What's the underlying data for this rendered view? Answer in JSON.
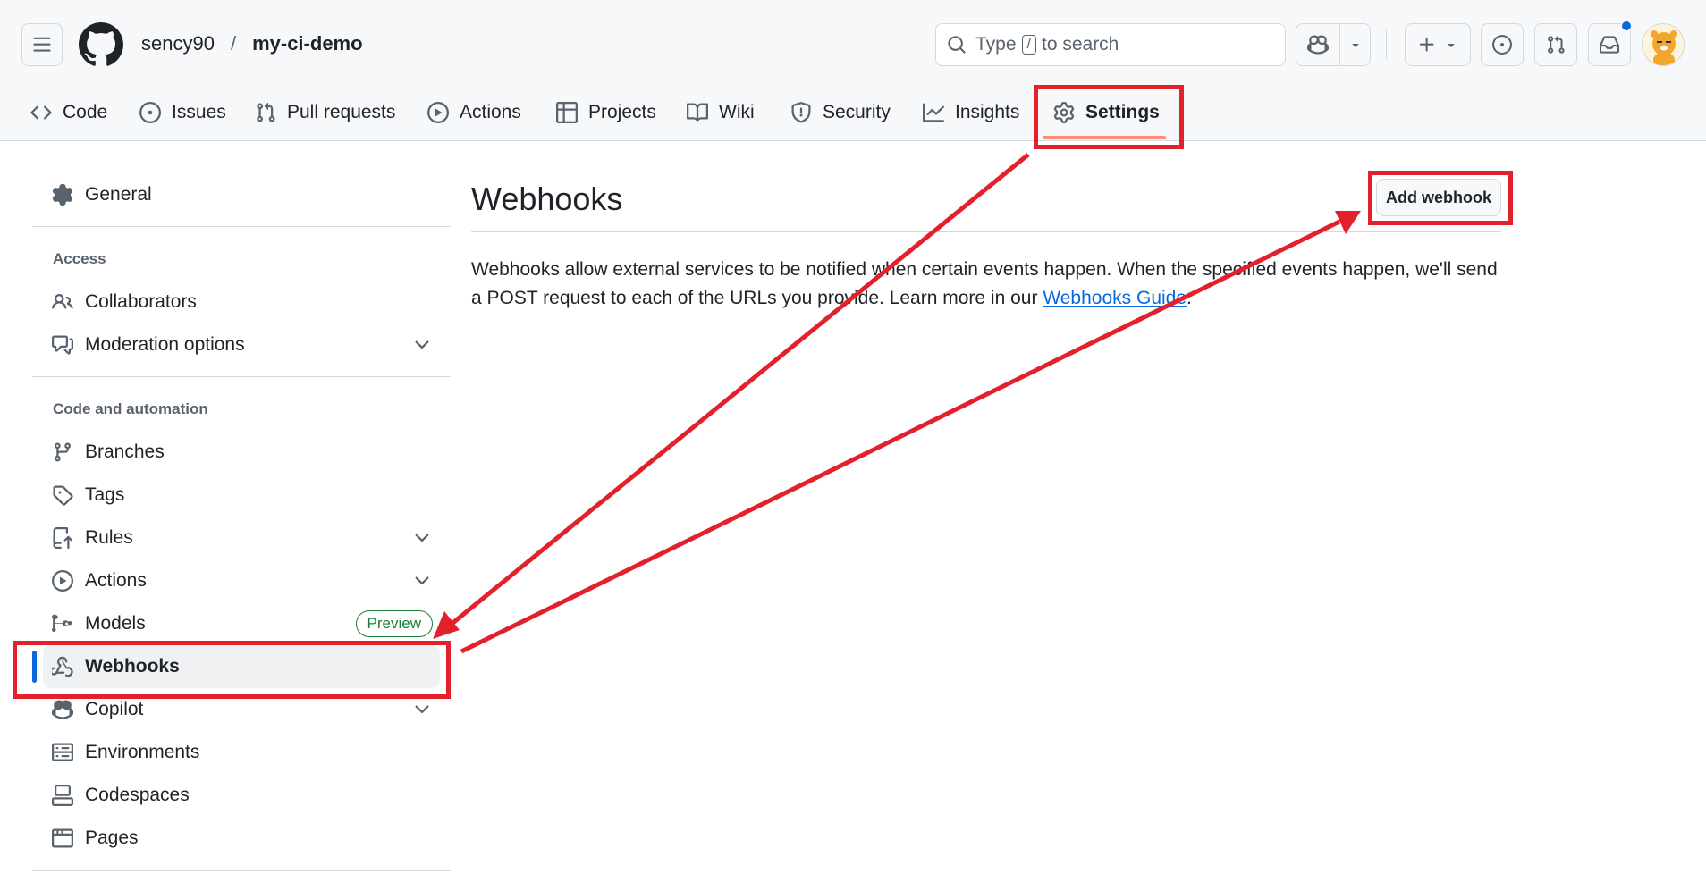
{
  "topbar": {
    "owner": "sency90",
    "separator": "/",
    "repo": "my-ci-demo",
    "search_prefix": "Type",
    "search_key": "/",
    "search_suffix": "to search"
  },
  "tabs": [
    {
      "label": "Code",
      "icon": "code-icon"
    },
    {
      "label": "Issues",
      "icon": "issue-icon"
    },
    {
      "label": "Pull requests",
      "icon": "pull-request-icon"
    },
    {
      "label": "Actions",
      "icon": "play-icon"
    },
    {
      "label": "Projects",
      "icon": "table-icon"
    },
    {
      "label": "Wiki",
      "icon": "book-icon"
    },
    {
      "label": "Security",
      "icon": "shield-icon"
    },
    {
      "label": "Insights",
      "icon": "graph-icon"
    },
    {
      "label": "Settings",
      "icon": "gear-icon",
      "active": true
    }
  ],
  "sidebar": {
    "general": "General",
    "access_heading": "Access",
    "collaborators": "Collaborators",
    "moderation": "Moderation options",
    "code_heading": "Code and automation",
    "branches": "Branches",
    "tags": "Tags",
    "rules": "Rules",
    "actions": "Actions",
    "models": "Models",
    "models_badge": "Preview",
    "webhooks": "Webhooks",
    "copilot": "Copilot",
    "environments": "Environments",
    "codespaces": "Codespaces",
    "pages": "Pages"
  },
  "main": {
    "title": "Webhooks",
    "add_button": "Add webhook",
    "description_line1": "Webhooks allow external services to be notified when certain events happen. When the specified events happen, we'll send",
    "description_line2": "a POST request to each of the URLs you provide. Learn more in our",
    "guide_link": "Webhooks Guide",
    "description_end": "."
  },
  "colors": {
    "accent": "#0969da",
    "annotation": "#e3212d",
    "tab_underline": "#fd8c73",
    "badge": "#1a7f37"
  }
}
